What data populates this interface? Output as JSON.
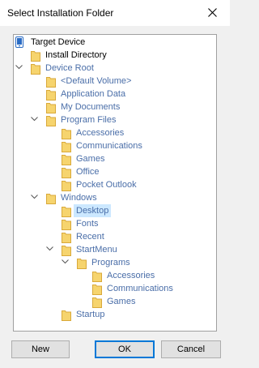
{
  "window": {
    "title": "Select Installation Folder"
  },
  "colors": {
    "folder": "#f6d46e",
    "selection": "#cce8ff",
    "label_blue": "#4a6ea8",
    "default_border": "#0078d7"
  },
  "tree": {
    "target_device": "Target Device",
    "install_directory": "Install Directory",
    "device_root": "Device Root",
    "default_volume": "<Default Volume>",
    "application_data": "Application Data",
    "my_documents": "My Documents",
    "program_files": "Program Files",
    "pf_accessories": "Accessories",
    "pf_communications": "Communications",
    "pf_games": "Games",
    "pf_office": "Office",
    "pf_pocket_outlook": "Pocket Outlook",
    "windows": "Windows",
    "desktop": "Desktop",
    "fonts": "Fonts",
    "recent": "Recent",
    "startmenu": "StartMenu",
    "programs": "Programs",
    "pr_accessories": "Accessories",
    "pr_communications": "Communications",
    "pr_games": "Games",
    "startup": "Startup"
  },
  "buttons": {
    "new": "New",
    "ok": "OK",
    "cancel": "Cancel"
  }
}
